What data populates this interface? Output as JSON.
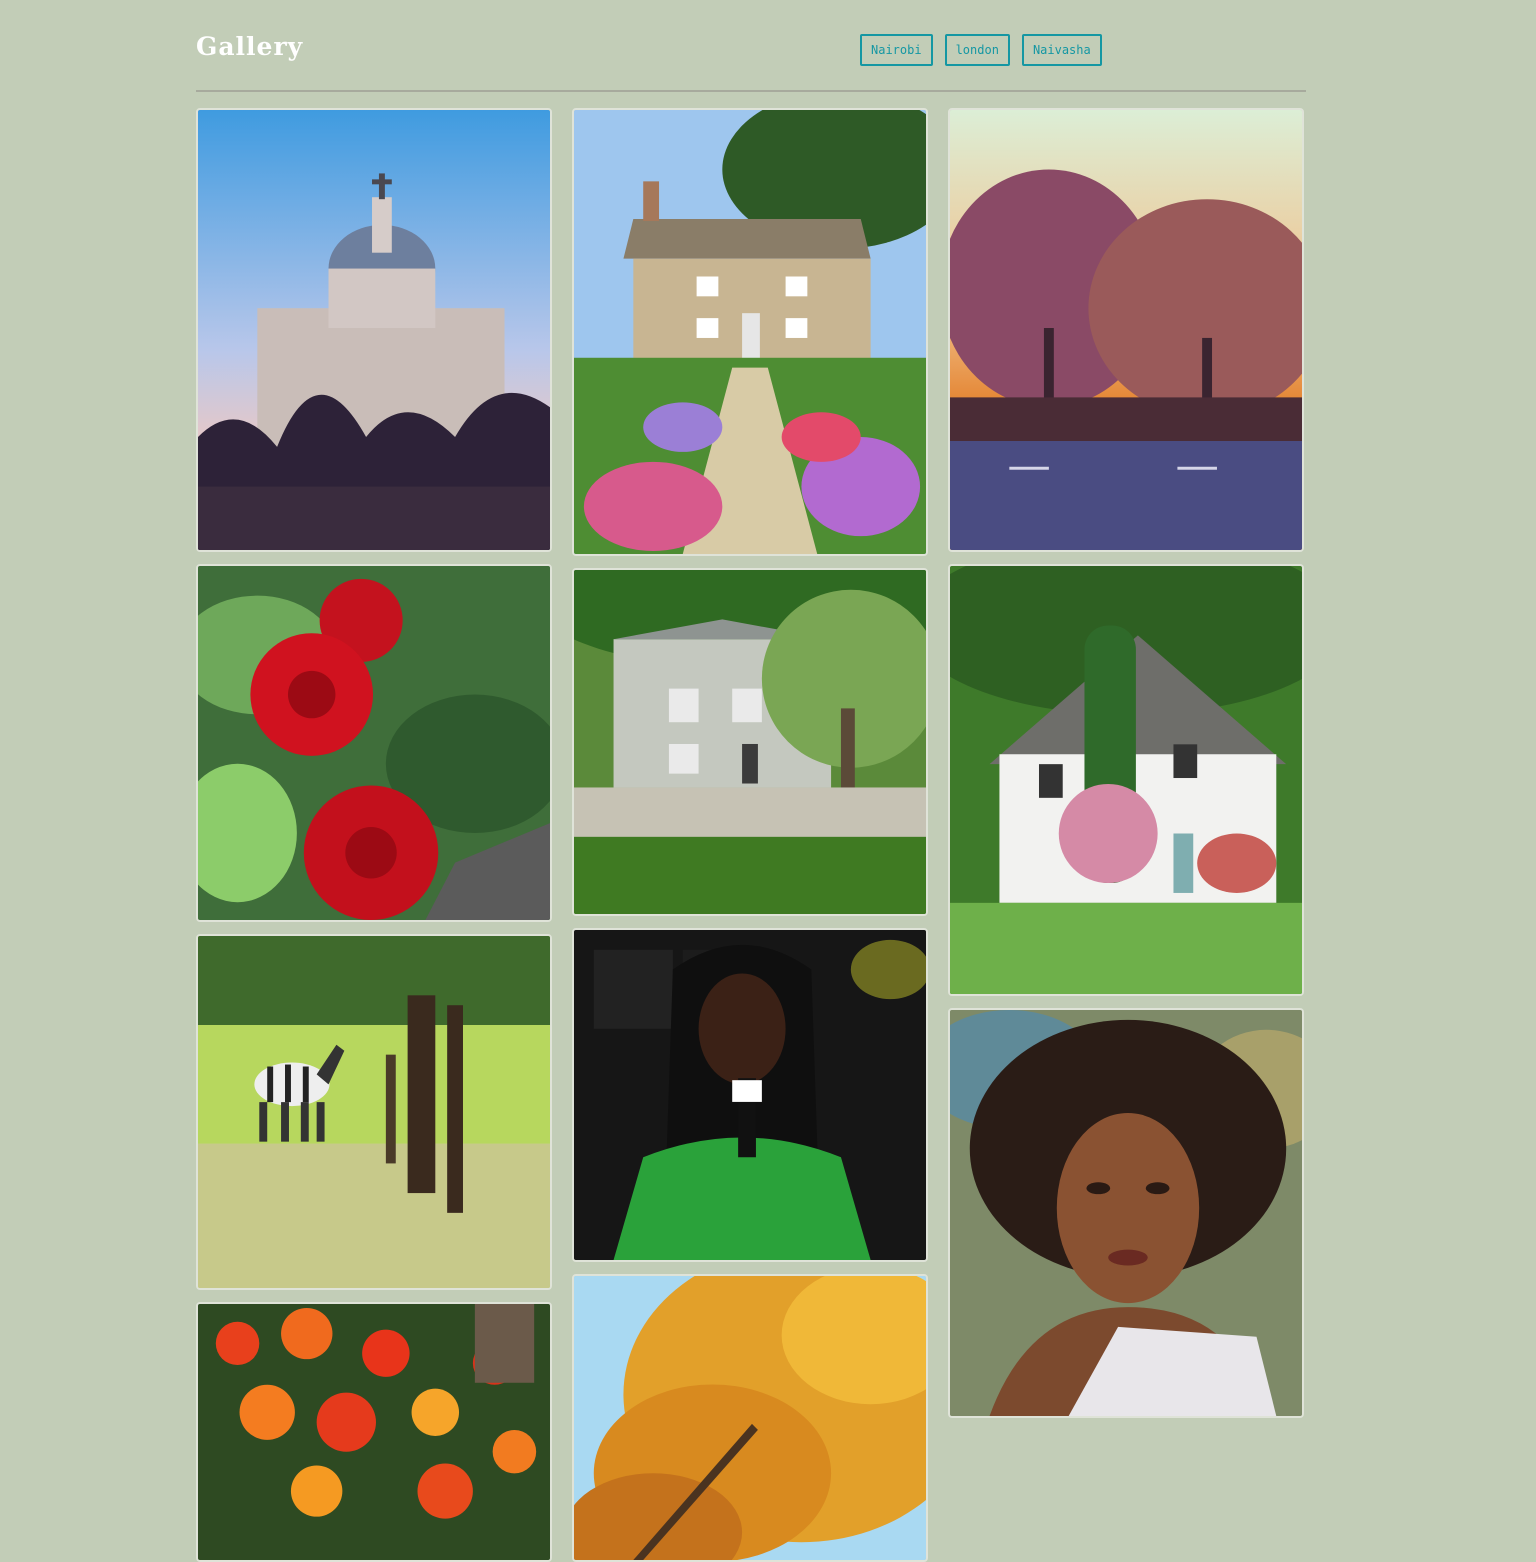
{
  "header": {
    "title": "Gallery"
  },
  "filters": [
    {
      "label": "Nairobi"
    },
    {
      "label": "london"
    },
    {
      "label": "Naivasha"
    }
  ],
  "colors": {
    "background": "#c2cdb7",
    "accent": "#1597a3",
    "title": "#ffffff"
  },
  "gallery": [
    {
      "subject": "domed-cathedral-photo"
    },
    {
      "subject": "stone-cottage-garden-path-photo"
    },
    {
      "subject": "trees-sunset-road-photo"
    },
    {
      "subject": "red-roses-photo"
    },
    {
      "subject": "country-manor-trees-photo"
    },
    {
      "subject": "white-house-ivy-photo"
    },
    {
      "subject": "zebra-in-park-photo"
    },
    {
      "subject": "woman-green-sweater-microphone-photo"
    },
    {
      "subject": "woman-portrait-painting"
    },
    {
      "subject": "orange-flowers-photo"
    },
    {
      "subject": "autumn-tree-photo"
    }
  ]
}
